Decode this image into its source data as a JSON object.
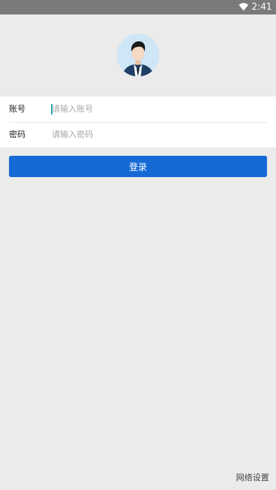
{
  "status_bar": {
    "time": "2:41",
    "icons": [
      "wifi-icon"
    ]
  },
  "avatar": {
    "icon": "user-avatar-icon",
    "colors": {
      "background": "#cfe6f7",
      "suit": "#1f3f66",
      "shirt": "#ffffff",
      "tie": "#1d2d47",
      "skin": "#f6d9c2",
      "hair": "#1c1c1c"
    }
  },
  "form": {
    "account": {
      "label": "账号",
      "placeholder": "请输入账号",
      "value": ""
    },
    "password": {
      "label": "密码",
      "placeholder": "请输入密码",
      "value": ""
    }
  },
  "login_button": {
    "label": "登录",
    "color": "#176ad6"
  },
  "footer": {
    "network_settings_label": "网络设置"
  }
}
